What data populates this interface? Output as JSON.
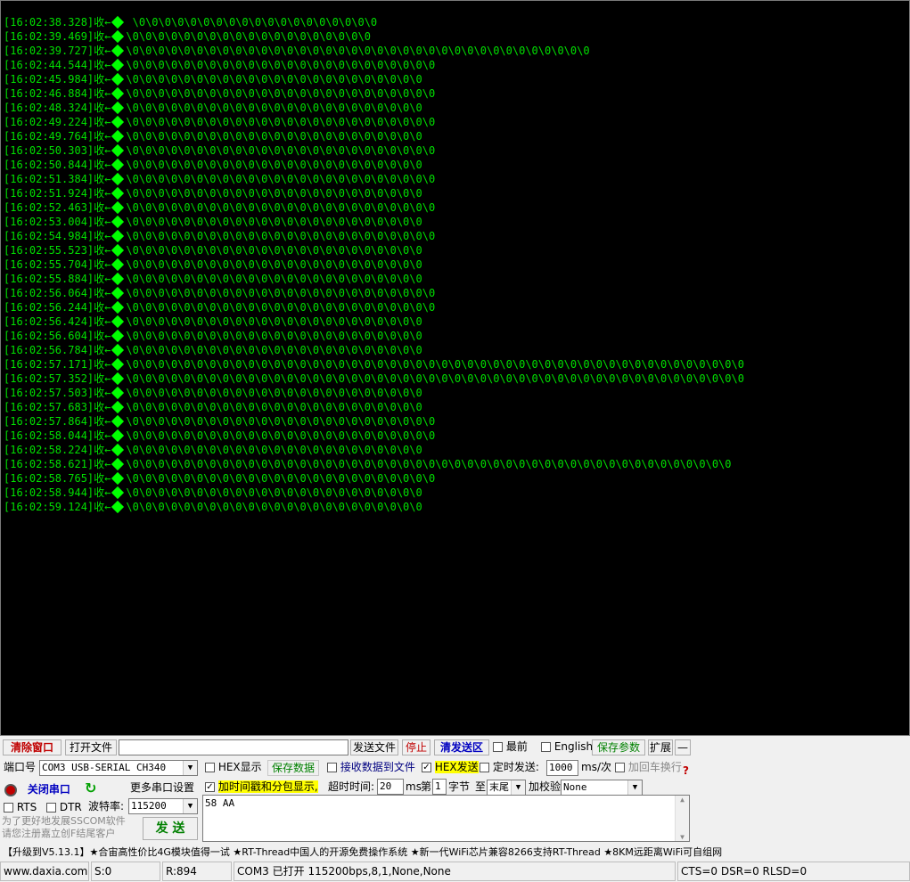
{
  "log": {
    "direction_label": "收←",
    "lines": [
      {
        "time": "[16:02:38.328]",
        "data": " \\0\\0\\0\\0\\0\\0\\0\\0\\0\\0\\0\\0\\0\\0\\0\\0\\0\\0\\0"
      },
      {
        "time": "[16:02:39.469]",
        "data": "\\0\\0\\0\\0\\0\\0\\0\\0\\0\\0\\0\\0\\0\\0\\0\\0\\0\\0\\0"
      },
      {
        "time": "[16:02:39.727]",
        "data": "\\0\\0\\0\\0\\0\\0\\0\\0\\0\\0\\0\\0\\0\\0\\0\\0\\0\\0\\0\\0\\0\\0\\0\\0\\0\\0\\0\\0\\0\\0\\0\\0\\0\\0\\0\\0"
      },
      {
        "time": "[16:02:44.544]",
        "data": "\\0\\0\\0\\0\\0\\0\\0\\0\\0\\0\\0\\0\\0\\0\\0\\0\\0\\0\\0\\0\\0\\0\\0\\0"
      },
      {
        "time": "[16:02:45.984]",
        "data": "\\0\\0\\0\\0\\0\\0\\0\\0\\0\\0\\0\\0\\0\\0\\0\\0\\0\\0\\0\\0\\0\\0\\0"
      },
      {
        "time": "[16:02:46.884]",
        "data": "\\0\\0\\0\\0\\0\\0\\0\\0\\0\\0\\0\\0\\0\\0\\0\\0\\0\\0\\0\\0\\0\\0\\0\\0"
      },
      {
        "time": "[16:02:48.324]",
        "data": "\\0\\0\\0\\0\\0\\0\\0\\0\\0\\0\\0\\0\\0\\0\\0\\0\\0\\0\\0\\0\\0\\0\\0"
      },
      {
        "time": "[16:02:49.224]",
        "data": "\\0\\0\\0\\0\\0\\0\\0\\0\\0\\0\\0\\0\\0\\0\\0\\0\\0\\0\\0\\0\\0\\0\\0\\0"
      },
      {
        "time": "[16:02:49.764]",
        "data": "\\0\\0\\0\\0\\0\\0\\0\\0\\0\\0\\0\\0\\0\\0\\0\\0\\0\\0\\0\\0\\0\\0\\0"
      },
      {
        "time": "[16:02:50.303]",
        "data": "\\0\\0\\0\\0\\0\\0\\0\\0\\0\\0\\0\\0\\0\\0\\0\\0\\0\\0\\0\\0\\0\\0\\0\\0"
      },
      {
        "time": "[16:02:50.844]",
        "data": "\\0\\0\\0\\0\\0\\0\\0\\0\\0\\0\\0\\0\\0\\0\\0\\0\\0\\0\\0\\0\\0\\0\\0"
      },
      {
        "time": "[16:02:51.384]",
        "data": "\\0\\0\\0\\0\\0\\0\\0\\0\\0\\0\\0\\0\\0\\0\\0\\0\\0\\0\\0\\0\\0\\0\\0\\0"
      },
      {
        "time": "[16:02:51.924]",
        "data": "\\0\\0\\0\\0\\0\\0\\0\\0\\0\\0\\0\\0\\0\\0\\0\\0\\0\\0\\0\\0\\0\\0\\0"
      },
      {
        "time": "[16:02:52.463]",
        "data": "\\0\\0\\0\\0\\0\\0\\0\\0\\0\\0\\0\\0\\0\\0\\0\\0\\0\\0\\0\\0\\0\\0\\0\\0"
      },
      {
        "time": "[16:02:53.004]",
        "data": "\\0\\0\\0\\0\\0\\0\\0\\0\\0\\0\\0\\0\\0\\0\\0\\0\\0\\0\\0\\0\\0\\0\\0"
      },
      {
        "time": "[16:02:54.984]",
        "data": "\\0\\0\\0\\0\\0\\0\\0\\0\\0\\0\\0\\0\\0\\0\\0\\0\\0\\0\\0\\0\\0\\0\\0\\0"
      },
      {
        "time": "[16:02:55.523]",
        "data": "\\0\\0\\0\\0\\0\\0\\0\\0\\0\\0\\0\\0\\0\\0\\0\\0\\0\\0\\0\\0\\0\\0\\0"
      },
      {
        "time": "[16:02:55.704]",
        "data": "\\0\\0\\0\\0\\0\\0\\0\\0\\0\\0\\0\\0\\0\\0\\0\\0\\0\\0\\0\\0\\0\\0\\0"
      },
      {
        "time": "[16:02:55.884]",
        "data": "\\0\\0\\0\\0\\0\\0\\0\\0\\0\\0\\0\\0\\0\\0\\0\\0\\0\\0\\0\\0\\0\\0\\0"
      },
      {
        "time": "[16:02:56.064]",
        "data": "\\0\\0\\0\\0\\0\\0\\0\\0\\0\\0\\0\\0\\0\\0\\0\\0\\0\\0\\0\\0\\0\\0\\0\\0"
      },
      {
        "time": "[16:02:56.244]",
        "data": "\\0\\0\\0\\0\\0\\0\\0\\0\\0\\0\\0\\0\\0\\0\\0\\0\\0\\0\\0\\0\\0\\0\\0\\0"
      },
      {
        "time": "[16:02:56.424]",
        "data": "\\0\\0\\0\\0\\0\\0\\0\\0\\0\\0\\0\\0\\0\\0\\0\\0\\0\\0\\0\\0\\0\\0\\0"
      },
      {
        "time": "[16:02:56.604]",
        "data": "\\0\\0\\0\\0\\0\\0\\0\\0\\0\\0\\0\\0\\0\\0\\0\\0\\0\\0\\0\\0\\0\\0\\0"
      },
      {
        "time": "[16:02:56.784]",
        "data": "\\0\\0\\0\\0\\0\\0\\0\\0\\0\\0\\0\\0\\0\\0\\0\\0\\0\\0\\0\\0\\0\\0\\0"
      },
      {
        "time": "[16:02:57.171]",
        "data": "\\0\\0\\0\\0\\0\\0\\0\\0\\0\\0\\0\\0\\0\\0\\0\\0\\0\\0\\0\\0\\0\\0\\0\\0\\0\\0\\0\\0\\0\\0\\0\\0\\0\\0\\0\\0\\0\\0\\0\\0\\0\\0\\0\\0\\0\\0\\0\\0"
      },
      {
        "time": "[16:02:57.352]",
        "data": "\\0\\0\\0\\0\\0\\0\\0\\0\\0\\0\\0\\0\\0\\0\\0\\0\\0\\0\\0\\0\\0\\0\\0\\0\\0\\0\\0\\0\\0\\0\\0\\0\\0\\0\\0\\0\\0\\0\\0\\0\\0\\0\\0\\0\\0\\0\\0\\0"
      },
      {
        "time": "[16:02:57.503]",
        "data": "\\0\\0\\0\\0\\0\\0\\0\\0\\0\\0\\0\\0\\0\\0\\0\\0\\0\\0\\0\\0\\0\\0\\0"
      },
      {
        "time": "[16:02:57.683]",
        "data": "\\0\\0\\0\\0\\0\\0\\0\\0\\0\\0\\0\\0\\0\\0\\0\\0\\0\\0\\0\\0\\0\\0\\0"
      },
      {
        "time": "[16:02:57.864]",
        "data": "\\0\\0\\0\\0\\0\\0\\0\\0\\0\\0\\0\\0\\0\\0\\0\\0\\0\\0\\0\\0\\0\\0\\0\\0"
      },
      {
        "time": "[16:02:58.044]",
        "data": "\\0\\0\\0\\0\\0\\0\\0\\0\\0\\0\\0\\0\\0\\0\\0\\0\\0\\0\\0\\0\\0\\0\\0\\0"
      },
      {
        "time": "[16:02:58.224]",
        "data": "\\0\\0\\0\\0\\0\\0\\0\\0\\0\\0\\0\\0\\0\\0\\0\\0\\0\\0\\0\\0\\0\\0\\0"
      },
      {
        "time": "[16:02:58.621]",
        "data": "\\0\\0\\0\\0\\0\\0\\0\\0\\0\\0\\0\\0\\0\\0\\0\\0\\0\\0\\0\\0\\0\\0\\0\\0\\0\\0\\0\\0\\0\\0\\0\\0\\0\\0\\0\\0\\0\\0\\0\\0\\0\\0\\0\\0\\0\\0\\0"
      },
      {
        "time": "[16:02:58.765]",
        "data": "\\0\\0\\0\\0\\0\\0\\0\\0\\0\\0\\0\\0\\0\\0\\0\\0\\0\\0\\0\\0\\0\\0\\0\\0"
      },
      {
        "time": "[16:02:58.944]",
        "data": "\\0\\0\\0\\0\\0\\0\\0\\0\\0\\0\\0\\0\\0\\0\\0\\0\\0\\0\\0\\0\\0\\0\\0"
      },
      {
        "time": "[16:02:59.124]",
        "data": "\\0\\0\\0\\0\\0\\0\\0\\0\\0\\0\\0\\0\\0\\0\\0\\0\\0\\0\\0\\0\\0\\0\\0"
      }
    ]
  },
  "toolbar": {
    "clear_window": "清除窗口",
    "open_file": "打开文件",
    "file_path": "",
    "send_file": "发送文件",
    "stop": "停止",
    "clear_send": "清发送区",
    "topmost": "最前",
    "english": "English",
    "save_params": "保存参数",
    "expand": "扩展",
    "collapse": "—"
  },
  "port": {
    "port_label": "端口号",
    "port_value": "COM3 USB-SERIAL CH340",
    "close_port": "关闭串口",
    "more_settings": "更多串口设置",
    "rts": "RTS",
    "dtr": "DTR",
    "baud_label": "波特率:",
    "baud_value": "115200",
    "promo_line1": "为了更好地发展SSCOM软件",
    "promo_line2": "请您注册嘉立创F结尾客户",
    "send_button": "发 送"
  },
  "options": {
    "hex_display": "HEX显示",
    "save_data": "保存数据",
    "recv_to_file": "接收数据到文件",
    "hex_send": "HEX发送",
    "timed_send": "定时发送:",
    "interval": "1000",
    "interval_unit": "ms/次",
    "add_crlf": "加回车换行",
    "timestamp": "加时间戳和分包显示,",
    "timeout_label": "超时时间:",
    "timeout_value": "20",
    "timeout_unit": "ms",
    "nth_label": "第",
    "nth_value": "1",
    "byte_label": "字节",
    "to_label": "至",
    "end_value": "末尾",
    "checksum_label": "加校验",
    "checksum_value": "None",
    "help": "?"
  },
  "send_area": {
    "content": "58  AA"
  },
  "ticker": "【升级到V5.13.1】★合宙高性价比4G模块值得一试 ★RT-Thread中国人的开源免费操作系统 ★新一代WiFi芯片兼容8266支持RT-Thread ★8KM远距离WiFi可自组网",
  "status": {
    "website": "www.daxia.com",
    "sent": "S:0",
    "received": "R:894",
    "port_status": "COM3 已打开  115200bps,8,1,None,None",
    "lines": "CTS=0 DSR=0 RLSD=0"
  }
}
